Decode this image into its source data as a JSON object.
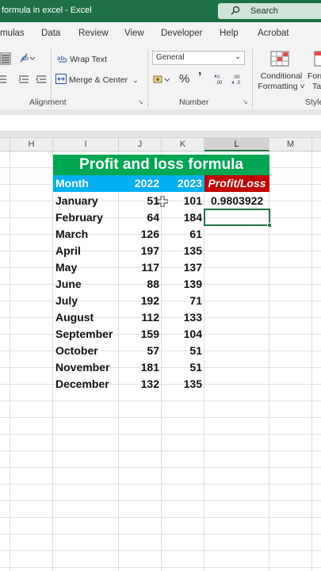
{
  "window": {
    "title": "formula in excel  -  Excel",
    "search_placeholder": "Search"
  },
  "menu": {
    "tabs": [
      "mulas",
      "Data",
      "Review",
      "View",
      "Developer",
      "Help",
      "Acrobat"
    ]
  },
  "ribbon": {
    "wrap_text": "Wrap Text",
    "merge_center": "Merge & Center",
    "number_format": "General",
    "percent": "%",
    "comma": "’",
    "conditional_formatting_line1": "Conditional",
    "conditional_formatting_line2": "Formatting ˅",
    "format_as_table_line1": "Forr",
    "format_as_table_line2": "Tal",
    "group_alignment": "Alignment",
    "group_number": "Number",
    "group_styles": "Style"
  },
  "columns": [
    "H",
    "I",
    "J",
    "K",
    "L",
    "M"
  ],
  "sheet": {
    "title": "Profit and loss formula",
    "headers": {
      "month": "Month",
      "y2022": "2022",
      "y2023": "2023",
      "profit_loss": "Profit/Loss"
    },
    "rows": [
      {
        "month": "January",
        "y2022": "51",
        "y2023": "101",
        "pl": "0.9803922"
      },
      {
        "month": "February",
        "y2022": "64",
        "y2023": "184",
        "pl": ""
      },
      {
        "month": "March",
        "y2022": "126",
        "y2023": "61",
        "pl": ""
      },
      {
        "month": "April",
        "y2022": "197",
        "y2023": "135",
        "pl": ""
      },
      {
        "month": "May",
        "y2022": "117",
        "y2023": "137",
        "pl": ""
      },
      {
        "month": "June",
        "y2022": "88",
        "y2023": "139",
        "pl": ""
      },
      {
        "month": "July",
        "y2022": "192",
        "y2023": "71",
        "pl": ""
      },
      {
        "month": "August",
        "y2022": "112",
        "y2023": "133",
        "pl": ""
      },
      {
        "month": "September",
        "y2022": "159",
        "y2023": "104",
        "pl": ""
      },
      {
        "month": "October",
        "y2022": "57",
        "y2023": "51",
        "pl": ""
      },
      {
        "month": "November",
        "y2022": "181",
        "y2023": "51",
        "pl": ""
      },
      {
        "month": "December",
        "y2022": "132",
        "y2023": "135",
        "pl": ""
      }
    ]
  },
  "colors": {
    "title_bar": "#1e7145",
    "table_title_bg": "#00a651",
    "header_blue": "#00b0f0",
    "header_red": "#c00000",
    "selection": "#217346"
  }
}
